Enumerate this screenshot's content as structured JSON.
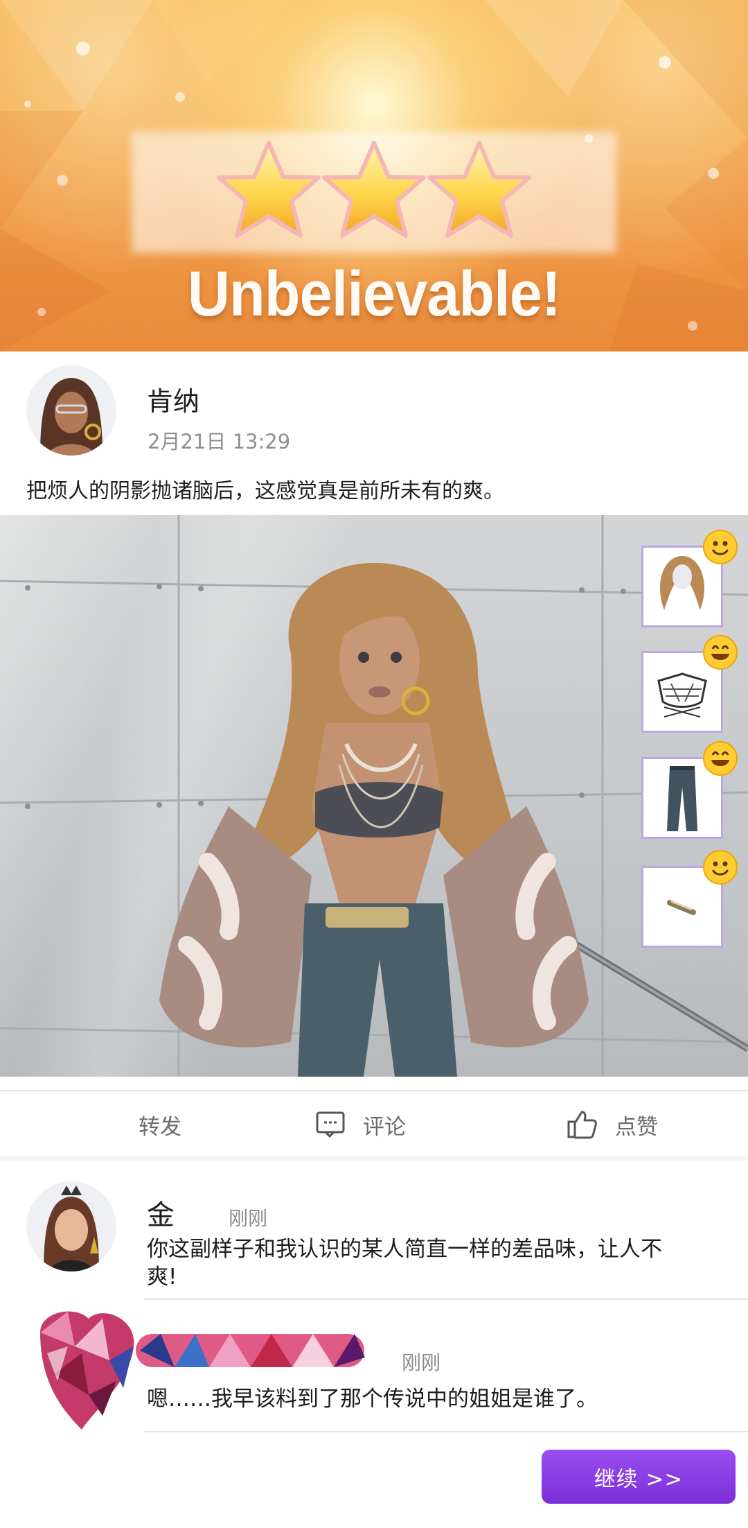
{
  "result": {
    "stars_earned": 3,
    "stars_total": 3,
    "title": "Unbelievable!"
  },
  "post": {
    "author": "肯纳",
    "time": "2月21日 13:29",
    "text": "把烦人的阴影抛诸脑后，这感觉真是前所未有的爽。"
  },
  "outfit_items": [
    {
      "icon": "hair-wig-icon",
      "reaction": "smile-emoji"
    },
    {
      "icon": "bra-top-icon",
      "reaction": "grin-emoji"
    },
    {
      "icon": "jeans-icon",
      "reaction": "grin-emoji"
    },
    {
      "icon": "hair-clip-icon",
      "reaction": "smile-emoji"
    }
  ],
  "actions": {
    "repost": "转发",
    "comment": "评论",
    "like": "点赞"
  },
  "comments": [
    {
      "name": "金",
      "time": "刚刚",
      "text_line1": "你这副样子和我认识的某人简直一样的差品味，让人不",
      "text_line2": "爽!"
    },
    {
      "name": "",
      "time": "刚刚",
      "text": "嗯……我早该料到了那个传说中的姐姐是谁了。"
    }
  ],
  "continue_label": "继续 >>",
  "colors": {
    "accent_purple": "#8a3ee6",
    "banner_orange": "#f2a14a",
    "star_gold": "#ffd54a"
  }
}
